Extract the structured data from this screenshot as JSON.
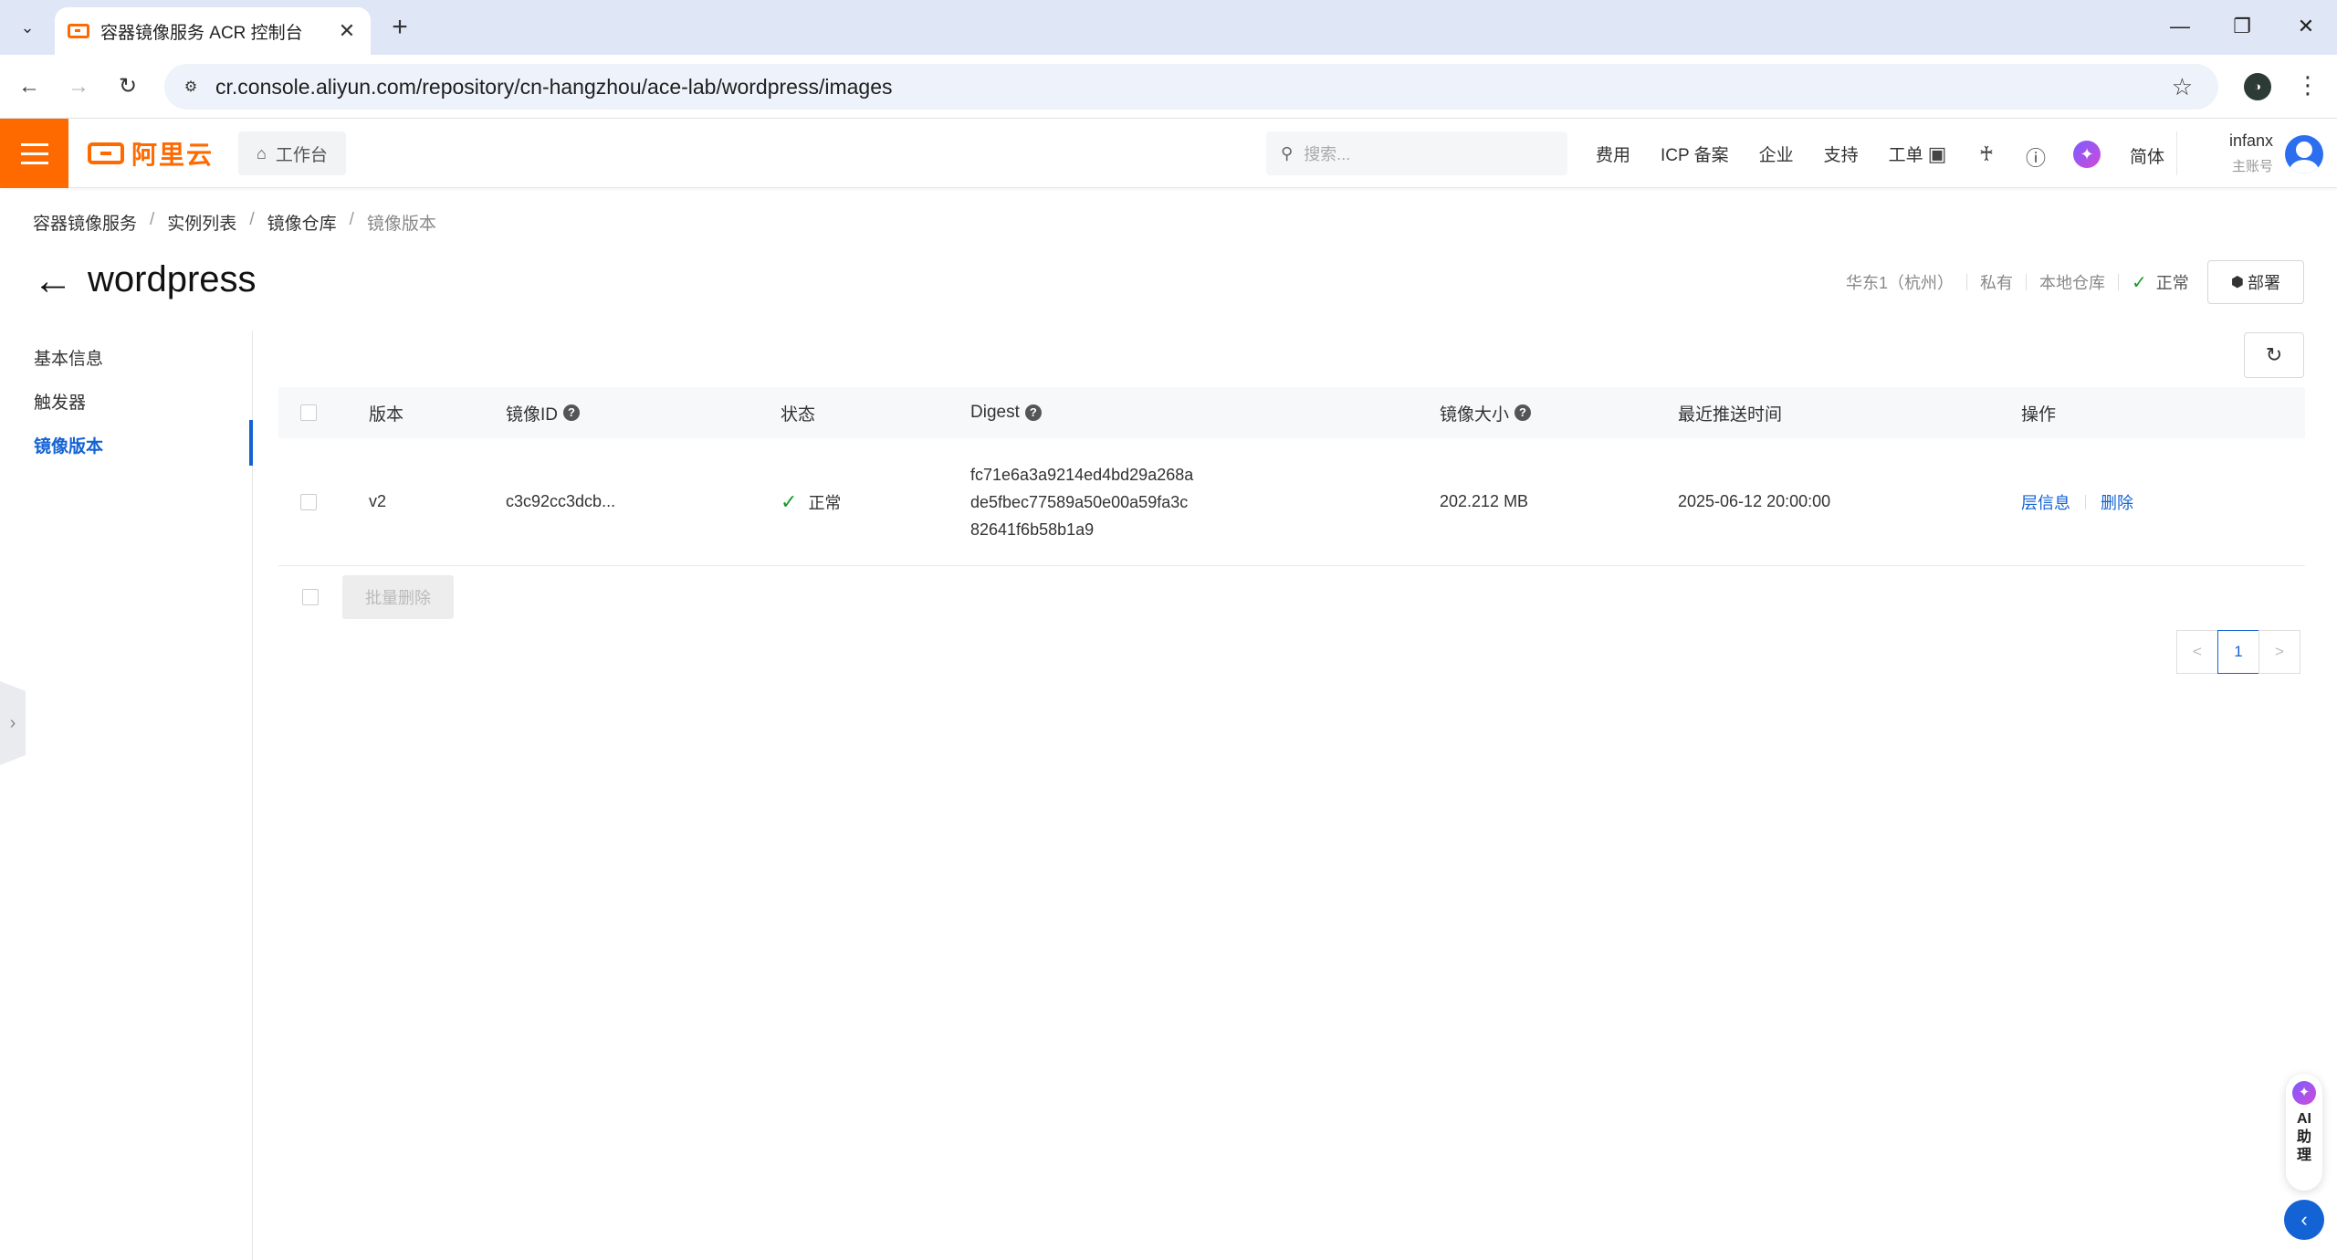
{
  "browser": {
    "tab_title": "容器镜像服务 ACR 控制台",
    "url": "cr.console.aliyun.com/repository/cn-hangzhou/ace-lab/wordpress/images",
    "profile_initial": "◑"
  },
  "topnav": {
    "logo_text": "阿里云",
    "workbench": "工作台",
    "search_placeholder": "搜索...",
    "links": [
      "费用",
      "ICP 备案",
      "企业",
      "支持",
      "工单"
    ],
    "lang": "简体",
    "user_name": "infanx",
    "user_role": "主账号"
  },
  "breadcrumb": [
    "容器镜像服务",
    "实例列表",
    "镜像仓库",
    "镜像版本"
  ],
  "page": {
    "title": "wordpress",
    "region": "华东1（杭州）",
    "visibility": "私有",
    "repo_type": "本地仓库",
    "status": "正常",
    "deploy_label": "部署"
  },
  "sidemenu": {
    "items": [
      "基本信息",
      "触发器",
      "镜像版本"
    ],
    "active_index": 2
  },
  "table": {
    "headers": [
      "版本",
      "镜像ID",
      "状态",
      "Digest",
      "镜像大小",
      "最近推送时间",
      "操作"
    ],
    "rows": [
      {
        "version": "v2",
        "image_id": "c3c92cc3dcb...",
        "status": "正常",
        "digest": [
          "fc71e6a3a9214ed4bd29a268a",
          "de5fbec77589a50e00a59fa3c",
          "82641f6b58b1a9"
        ],
        "size": "202.212 MB",
        "pushed_at": "2025-06-12 20:00:00",
        "actions": [
          "层信息",
          "删除"
        ]
      }
    ],
    "batch_delete": "批量删除"
  },
  "pagination": {
    "current": "1",
    "prev": "<",
    "next": ">"
  },
  "ai_helper": {
    "label": "AI助理"
  },
  "colors": {
    "brand": "#ff6a00",
    "link": "#1463d4",
    "success": "#1a9b2a"
  }
}
